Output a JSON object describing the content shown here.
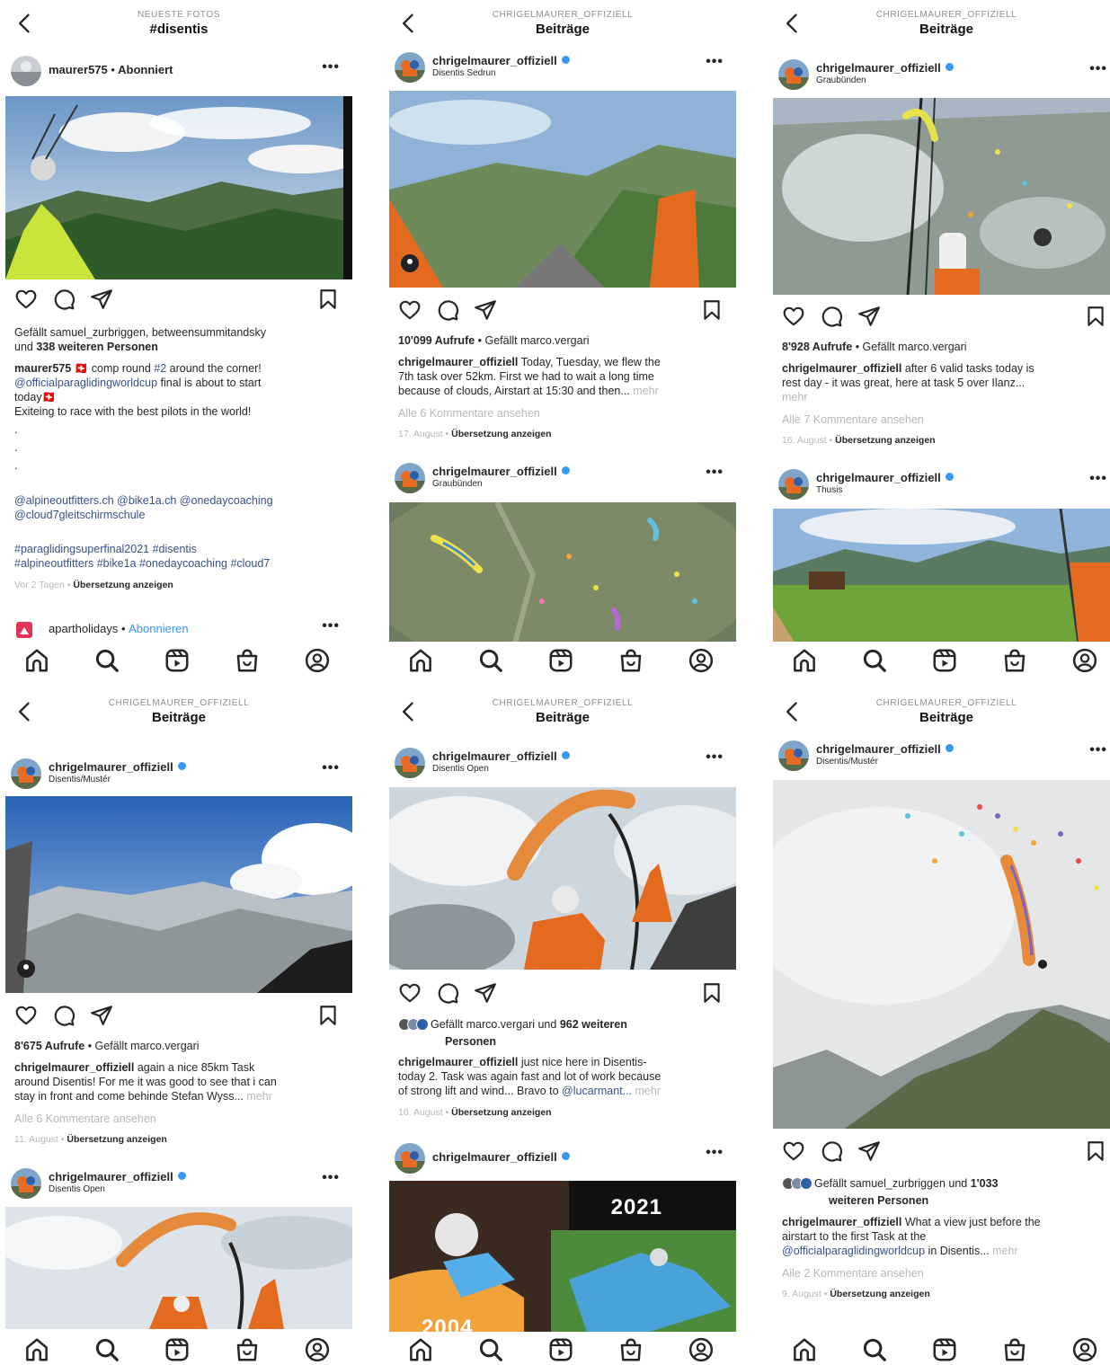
{
  "nav_icons": [
    "home-icon",
    "search-icon",
    "reels-icon",
    "shop-icon",
    "profile-icon"
  ],
  "panels": [
    {
      "header": {
        "supertitle": "NEUESTE FOTOS",
        "title": "#disentis"
      },
      "posts": [
        {
          "username": "maurer575",
          "follow_sep": "•",
          "follow_label": "Abonniert",
          "menu": "•••",
          "likes_prefix": "Gefällt samuel_zurbriggen, betweensummitandsky",
          "likes_line2_prefix": "und ",
          "likes_line2_bold": "338 weiteren Personen",
          "caption_user": "maurer575",
          "caption_l1": " 🇨🇭 comp round ",
          "caption_tag1": "#2",
          "caption_l1b": " around the corner!",
          "caption_mention": "@officialparaglidingworldcup",
          "caption_l2b": " final is about to start",
          "caption_l3": "today🇨🇭",
          "caption_l4": "Exiteing to race with the best pilots in the world!",
          "dots": [
            ".",
            ".",
            "."
          ],
          "mentions_l1": "@alpineoutfitters.ch @bike1a.ch @onedaycoaching",
          "mentions_l2": "@cloud7gleitschirmschule",
          "tags_l1": "#paraglidingsuperfinal2021 #disentis",
          "tags_l2": "#alpineoutfitters #bike1a #onedaycoaching #cloud7",
          "time": "Vor 2 Tagen",
          "translate": "Übersetzung anzeigen"
        },
        {
          "username": "apartholidays",
          "follow_sep": "•",
          "follow_label": "Abonnieren",
          "menu": "•••"
        }
      ]
    },
    {
      "header": {
        "supertitle": "CHRIGELMAURER_OFFIZIELL",
        "title": "Beiträge"
      },
      "posts": [
        {
          "username": "chrigelmaurer_offiziell",
          "location": "Disentis Sedrun",
          "menu": "•••",
          "views": "10'099 Aufrufe",
          "liked_by": " • Gefällt marco.vergari",
          "caption_user": "chrigelmaurer_offiziell",
          "caption_l1": " Today, Tuesday, we flew the",
          "caption_l2": "7th task over 52km. First we had to wait a long time",
          "caption_l3": "because of clouds, Airstart at 15:30 and then...",
          "more": " mehr",
          "comments": "Alle 6 Kommentare ansehen",
          "date": "17. August",
          "translate": "Übersetzung anzeigen"
        },
        {
          "username": "chrigelmaurer_offiziell",
          "location": "Graubünden",
          "menu": "•••"
        }
      ]
    },
    {
      "header": {
        "supertitle": "CHRIGELMAURER_OFFIZIELL",
        "title": "Beiträge"
      },
      "posts": [
        {
          "username": "chrigelmaurer_offiziell",
          "location": "Graubünden",
          "menu": "•••",
          "views": "8'928 Aufrufe",
          "liked_by": " • Gefällt marco.vergari",
          "caption_user": "chrigelmaurer_offiziell",
          "caption_l1": " after 6 valid tasks today is",
          "caption_l2": "rest day - it was great, here at task 5 over Ilanz...",
          "more": "mehr",
          "comments": "Alle 7 Kommentare ansehen",
          "date": "16. August",
          "translate": "Übersetzung anzeigen"
        },
        {
          "username": "chrigelmaurer_offiziell",
          "location": "Thusis",
          "menu": "•••"
        }
      ]
    },
    {
      "header": {
        "supertitle": "CHRIGELMAURER_OFFIZIELL",
        "title": "Beiträge"
      },
      "posts": [
        {
          "username": "chrigelmaurer_offiziell",
          "location": "Disentis/Mustér",
          "menu": "•••",
          "views": "8'675 Aufrufe",
          "liked_by": " • Gefällt marco.vergari",
          "caption_user": "chrigelmaurer_offiziell",
          "caption_l1": " again a nice 85km Task",
          "caption_l2": "around Disentis! For me it was good to see that i can",
          "caption_l3": "stay in front and come behinde Stefan Wyss...",
          "more": " mehr",
          "comments": "Alle 6 Kommentare ansehen",
          "date": "11. August",
          "translate": "Übersetzung anzeigen"
        },
        {
          "username": "chrigelmaurer_offiziell",
          "location": "Disentis Open",
          "menu": "•••"
        }
      ]
    },
    {
      "header": {
        "supertitle": "CHRIGELMAURER_OFFIZIELL",
        "title": "Beiträge"
      },
      "posts": [
        {
          "username": "chrigelmaurer_offiziell",
          "location": "Disentis Open",
          "menu": "•••",
          "likes_prefix": "Gefällt marco.vergari und ",
          "likes_bold": "962 weiteren",
          "likes_line2": "Personen",
          "caption_user": "chrigelmaurer_offiziell",
          "caption_l1": " just nice here in Disentis-",
          "caption_l2": "today 2. Task was again fast and lot of work because",
          "caption_l3": "of strong lift and wind... Bravo to ",
          "caption_mention": "@lucarmant...",
          "more": " mehr",
          "date": "10. August",
          "translate": "Übersetzung anzeigen"
        },
        {
          "username": "chrigelmaurer_offiziell",
          "menu": "•••",
          "year_top": "2021",
          "year_bottom": "2004"
        }
      ]
    },
    {
      "header": {
        "supertitle": "CHRIGELMAURER_OFFIZIELL",
        "title": "Beiträge"
      },
      "posts": [
        {
          "username": "chrigelmaurer_offiziell",
          "location": "Disentis/Mustér",
          "menu": "•••",
          "likes_prefix": "Gefällt samuel_zurbriggen und ",
          "likes_bold": "1'033",
          "likes_line2": "weiteren Personen",
          "caption_user": "chrigelmaurer_offiziell",
          "caption_l1": " What a view just before the",
          "caption_l2": "airstart to the first Task at the",
          "caption_mention": "@officialparaglidingworldcup",
          "caption_l3b": " in Disentis...",
          "more": " mehr",
          "comments": "Alle 2 Kommentare ansehen",
          "date": "9. August",
          "translate": "Übersetzung anzeigen"
        }
      ]
    }
  ]
}
